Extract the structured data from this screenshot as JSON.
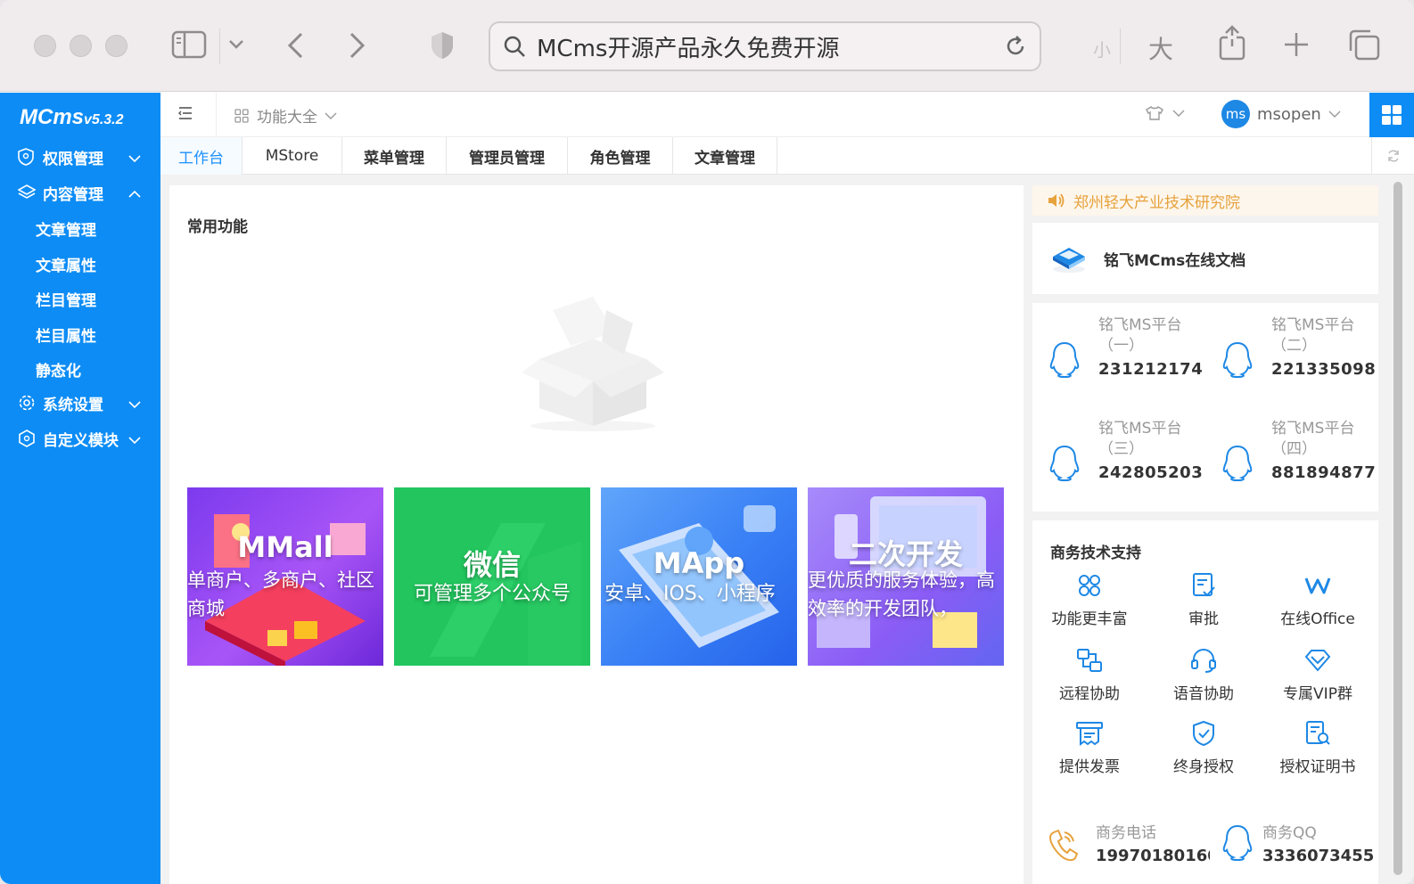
{
  "browser": {
    "url_text": "MCms开源产品永久免费开源",
    "font_small": "小",
    "font_large": "大"
  },
  "sidebar": {
    "logo": "MCms",
    "version": "v5.3.2",
    "menu": [
      {
        "label": "权限管理",
        "icon": "shield-icon",
        "expanded": false
      },
      {
        "label": "内容管理",
        "icon": "layers-icon",
        "expanded": true
      },
      {
        "label": "系统设置",
        "icon": "gear-icon",
        "expanded": false
      },
      {
        "label": "自定义模块",
        "icon": "cube-icon",
        "expanded": false
      }
    ],
    "sub_items": [
      "文章管理",
      "文章属性",
      "栏目管理",
      "栏目属性",
      "静态化"
    ],
    "color": "#0d8cf5"
  },
  "topbar": {
    "functions_label": "功能大全",
    "avatar_text": "ms",
    "username": "msopen"
  },
  "tabs": [
    "工作台",
    "MStore",
    "菜单管理",
    "管理员管理",
    "角色管理",
    "文章管理"
  ],
  "main": {
    "common_title": "常用功能",
    "cards": [
      {
        "title": "MMall",
        "subtitle": "单商户、多商户、社区商城",
        "color": "#7c3aed"
      },
      {
        "title": "微信",
        "subtitle": "可管理多个公众号",
        "color": "#22c55e"
      },
      {
        "title": "MApp",
        "subtitle": "安卓、IOS、小程序",
        "color": "#3b82f6"
      },
      {
        "title": "二次开发",
        "subtitle": "更优质的服务体验，高效率的开发团队，",
        "color": "#8b5cf6"
      }
    ]
  },
  "right": {
    "notice": "郑州轻大产业技术研究院",
    "doc_link": "铭飞MCms在线文档",
    "qq_groups": [
      {
        "name": "铭飞MS平台（一）",
        "number": "231212174"
      },
      {
        "name": "铭飞MS平台（二）",
        "number": "221335098"
      },
      {
        "name": "铭飞MS平台（三）",
        "number": "242805203"
      },
      {
        "name": "铭飞MS平台（四）",
        "number": "881894877"
      }
    ],
    "support_title": "商务技术支持",
    "support_items": [
      {
        "label": "功能更丰富",
        "icon": "grid-icon"
      },
      {
        "label": "审批",
        "icon": "approve-icon"
      },
      {
        "label": "在线Office",
        "icon": "office-icon"
      },
      {
        "label": "远程协助",
        "icon": "remote-icon"
      },
      {
        "label": "语音协助",
        "icon": "headset-icon"
      },
      {
        "label": "专属VIP群",
        "icon": "diamond-icon"
      },
      {
        "label": "提供发票",
        "icon": "invoice-icon"
      },
      {
        "label": "终身授权",
        "icon": "shield-check-icon"
      },
      {
        "label": "授权证明书",
        "icon": "certificate-icon"
      }
    ],
    "phone_label": "商务电话",
    "phone_value": "19970180160",
    "qq_label": "商务QQ",
    "qq_value": "3336073455"
  }
}
